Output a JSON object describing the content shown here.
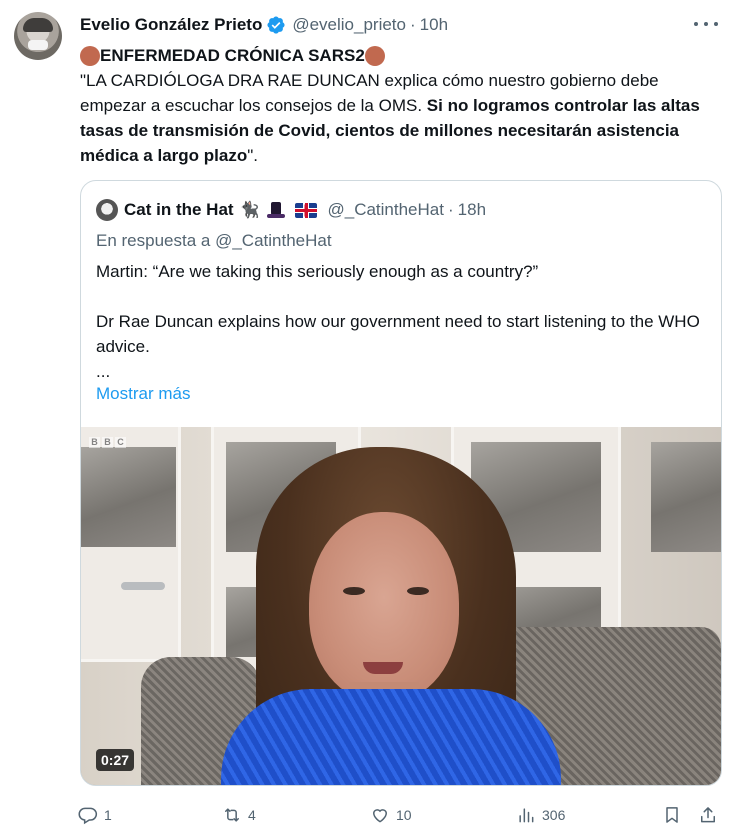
{
  "tweet": {
    "author": {
      "name": "Evelio González Prieto",
      "handle": "@evelio_prieto",
      "time": "10h",
      "verified_color": "#1d9bf0"
    },
    "text": {
      "headline": "ENFERMEDAD CRÓNICA SARS2",
      "headline_emoji_color": "#c1694f",
      "body_plain": "\"LA CARDIÓLOGA DRA RAE DUNCAN explica cómo nuestro gobierno debe empezar a escuchar los consejos de la OMS. ",
      "body_bold": "Si no logramos controlar las altas tasas de transmisión de Covid, cientos de millones necesitarán asistencia médica a largo plazo",
      "body_end": "\"."
    },
    "quoted": {
      "name": "Cat in the Hat",
      "emoji_cat": "🐈‍⬛",
      "handle": "@_CatintheHat",
      "time": "18h",
      "reply_to": "En respuesta a @_CatintheHat",
      "paragraph1": "Martin: “Are we taking this seriously enough as a country?”",
      "paragraph2": "Dr Rae Duncan explains how our government need to start listening to the WHO advice.",
      "ellipsis": "...",
      "show_more": "Mostrar más",
      "video": {
        "duration": "0:27",
        "watermark": [
          "B",
          "B",
          "C"
        ]
      }
    },
    "actions": {
      "replies": "1",
      "reposts": "4",
      "likes": "10",
      "views": "306"
    },
    "colors": {
      "link": "#1d9bf0",
      "secondary_text": "#536471",
      "border": "#cfd9de"
    }
  }
}
